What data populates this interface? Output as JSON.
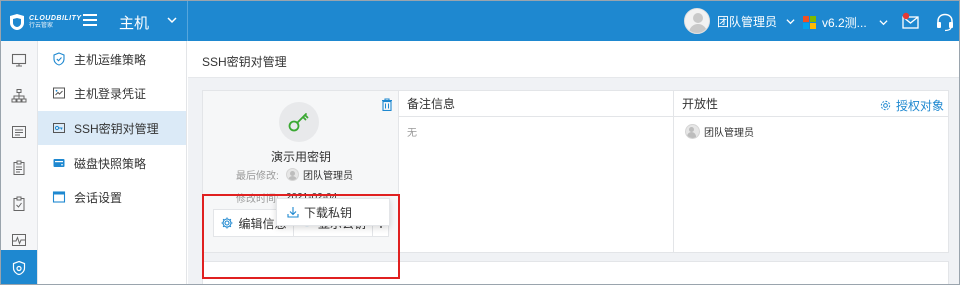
{
  "app": {
    "logo_title": "CLOUDBILITY",
    "logo_subtitle": "行云管家",
    "module_title": "主机"
  },
  "topbar": {
    "user_name": "团队管理员",
    "version_label": "v6.2测..."
  },
  "rail": {
    "icons": [
      "monitor-icon",
      "org-chart-icon",
      "list-icon",
      "clipboard-icon",
      "clipboard-check-icon",
      "pulse-icon",
      "shield-gear-icon"
    ],
    "active_index": 6
  },
  "submenu": {
    "items": [
      {
        "label": "主机运维策略",
        "icon": "shield-check-icon"
      },
      {
        "label": "主机登录凭证",
        "icon": "login-credential-icon"
      },
      {
        "label": "SSH密钥对管理",
        "icon": "key-card-icon"
      },
      {
        "label": "磁盘快照策略",
        "icon": "disk-icon"
      },
      {
        "label": "会话设置",
        "icon": "window-icon"
      }
    ],
    "active_index": 2
  },
  "breadcrumb": {
    "title": "SSH密钥对管理"
  },
  "key_card": {
    "name": "演示用密钥",
    "last_modified_label": "最后修改:",
    "last_modified_by": "团队管理员",
    "modified_time_label": "修改时间:",
    "modified_time": "2021-02-04",
    "edit_label": "编辑信息",
    "show_label": "显示公钥",
    "download_label": "下载私钥",
    "notes_header": "备注信息",
    "notes_value": "无",
    "openness_header": "开放性",
    "authorize_label": "授权对象",
    "open_user": "团队管理员"
  },
  "colors": {
    "primary": "#1e88d0",
    "active_menu_bg": "#dbeaf7",
    "highlight_red": "#e02020",
    "key_green": "#3aa832"
  }
}
